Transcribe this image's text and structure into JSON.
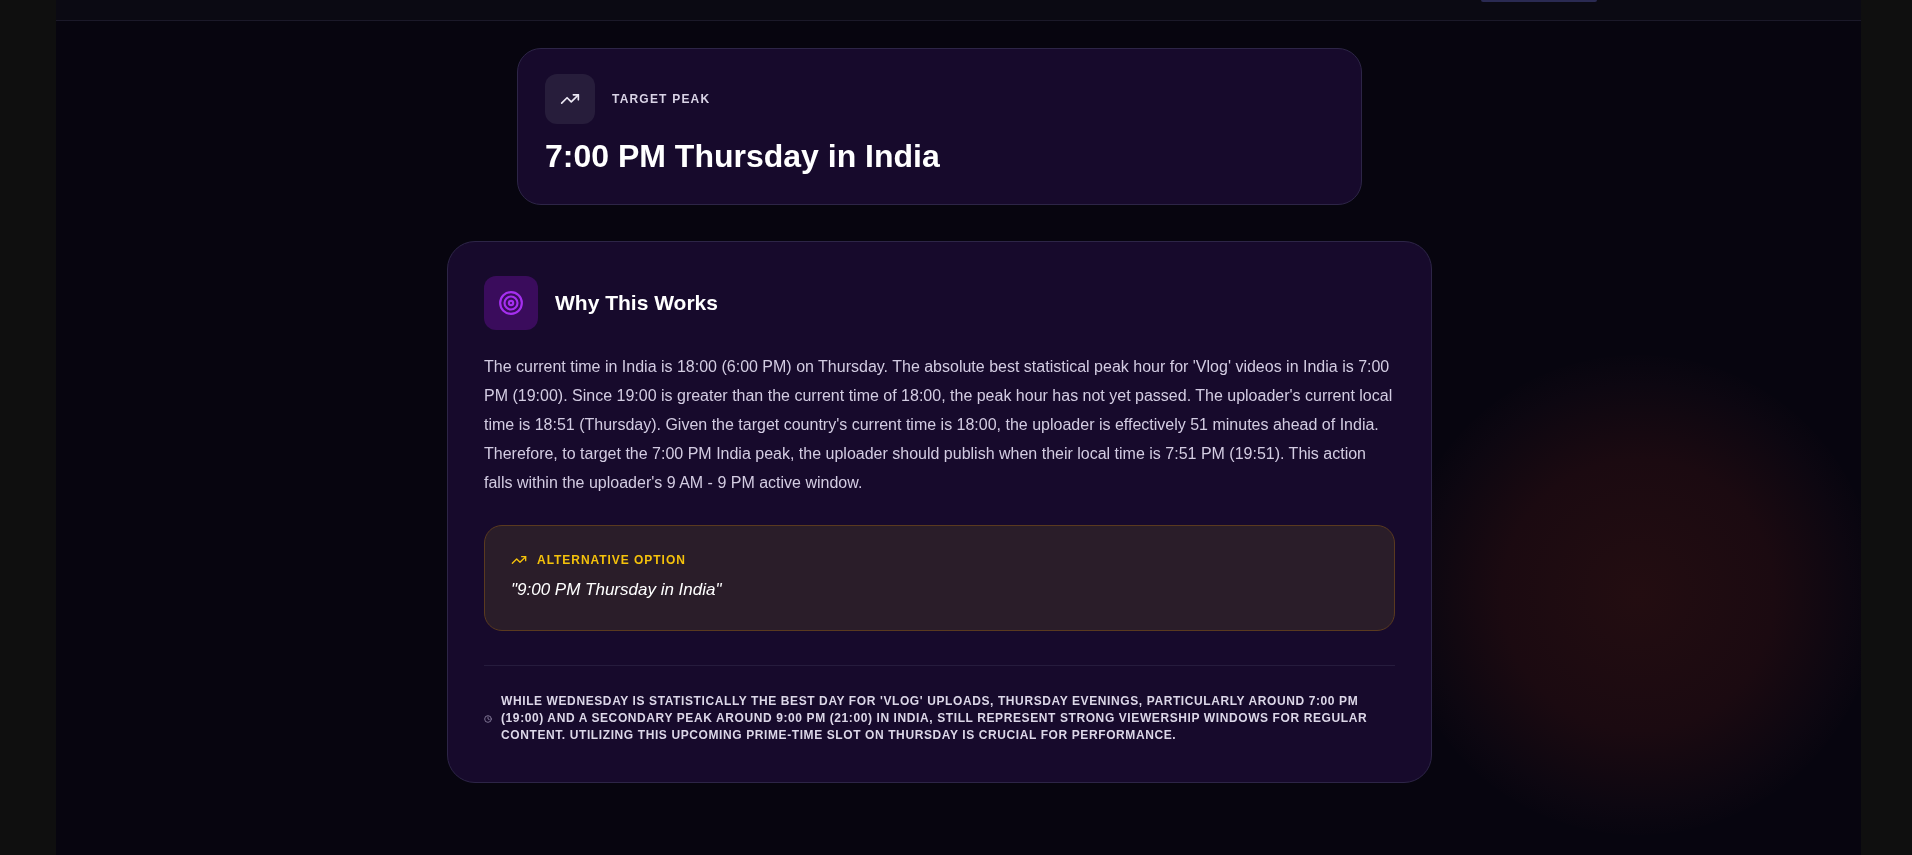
{
  "target_peak": {
    "label": "TARGET PEAK",
    "value": "7:00 PM Thursday in India"
  },
  "explanation": {
    "title": "Why This Works",
    "body": "The current time in India is 18:00 (6:00 PM) on Thursday. The absolute best statistical peak hour for 'Vlog' videos in India is 7:00 PM (19:00). Since 19:00 is greater than the current time of 18:00, the peak hour has not yet passed. The uploader's current local time is 18:51 (Thursday). Given the target country's current time is 18:00, the uploader is effectively 51 minutes ahead of India. Therefore, to target the 7:00 PM India peak, the uploader should publish when their local time is 7:51 PM (19:51). This action falls within the uploader's 9 AM - 9 PM active window.",
    "alternative": {
      "label": "ALTERNATIVE OPTION",
      "value": "\"9:00 PM Thursday in India\""
    },
    "note": "WHILE WEDNESDAY IS STATISTICALLY THE BEST DAY FOR 'VLOG' UPLOADS, THURSDAY EVENINGS, PARTICULARLY AROUND 7:00 PM (19:00) AND A SECONDARY PEAK AROUND 9:00 PM (21:00) IN INDIA, STILL REPRESENT STRONG VIEWERSHIP WINDOWS FOR REGULAR CONTENT. UTILIZING THIS UPCOMING PRIME-TIME SLOT ON THURSDAY IS CRUCIAL FOR PERFORMANCE."
  }
}
